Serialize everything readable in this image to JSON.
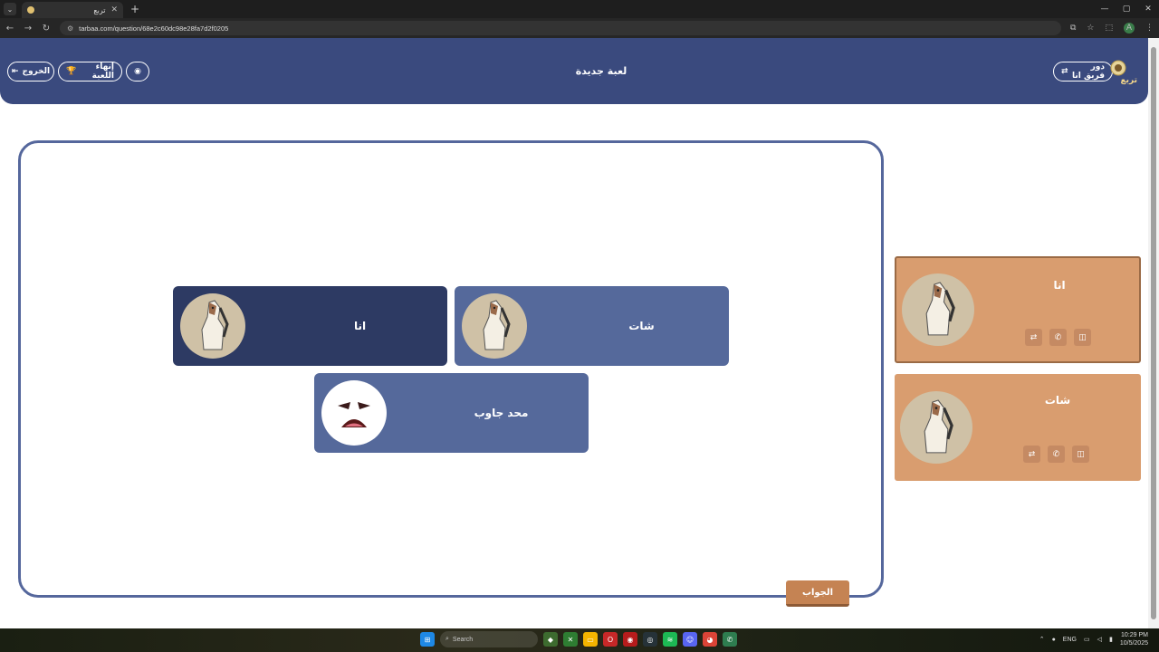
{
  "browser": {
    "tab_title": "تربع",
    "url": "tarbaa.com/question/68e2c60dc98e28fa7d2f0205"
  },
  "header": {
    "title": "لعبة جديدة",
    "team_turn_label": "دور فريق انا",
    "end_game_label": "إنهاء اللعبة",
    "exit_label": "الخروج",
    "logo_text": "تربع"
  },
  "board": {
    "players": [
      {
        "name": "انا",
        "avatar": "horse-icon",
        "color": "#2d3a63"
      },
      {
        "name": "شات",
        "avatar": "horse-icon",
        "color": "#55699b"
      },
      {
        "name": "محد جاوب",
        "avatar": "sad-face-icon",
        "color": "#55699b"
      }
    ],
    "answer_label": "الجواب"
  },
  "teams": [
    {
      "name": "انا",
      "avatar": "horse-icon"
    },
    {
      "name": "شات",
      "avatar": "horse-icon"
    }
  ],
  "taskbar": {
    "search_label": "Search",
    "language": "ENG",
    "time": "10:29 PM",
    "date": "10/5/2025"
  },
  "colors": {
    "header": "#3a4a7e",
    "board_border": "#55679c",
    "team_card": "#d99d6f",
    "answer_button": "#c58353"
  }
}
